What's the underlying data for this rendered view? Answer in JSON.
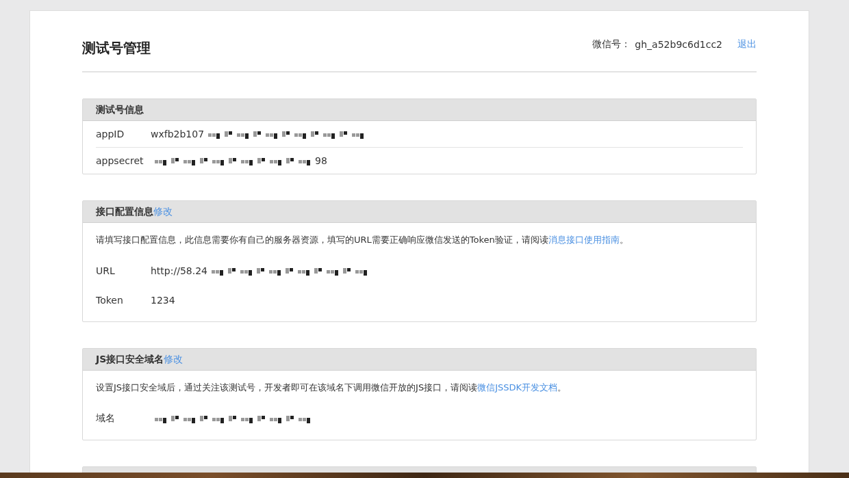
{
  "header": {
    "title": "测试号管理",
    "account_label": "微信号：",
    "account_id": "gh_a52b9c6d1cc2",
    "logout": "退出"
  },
  "sections": [
    {
      "kind": "list",
      "title": "测试号信息",
      "fields": [
        {
          "label": "appID",
          "prefix": "wxfb2b107",
          "redacted": true
        },
        {
          "label": "appsecret",
          "suffix": "98",
          "redacted": true
        }
      ]
    },
    {
      "kind": "text",
      "title": "接口配置信息",
      "edit_link": "修改",
      "description": {
        "text": "请填写接口配置信息，此信息需要你有自己的服务器资源，填写的URL需要正确响应微信发送的Token验证，请阅读",
        "link": "消息接口使用指南",
        "end": "。"
      },
      "fields": [
        {
          "label": "URL",
          "prefix": "http://58.24",
          "redacted": true
        },
        {
          "label": "Token",
          "prefix": "1234",
          "redacted": false
        }
      ]
    },
    {
      "kind": "text",
      "title": "JS接口安全域名",
      "edit_link": "修改",
      "description": {
        "text": "设置JS接口安全域后，通过关注该测试号，开发者即可在该域名下调用微信开放的JS接口，请阅读",
        "link": "微信JSSDK开发文档",
        "end": "。"
      },
      "fields": [
        {
          "label": "域名",
          "redacted": true
        }
      ]
    }
  ]
}
